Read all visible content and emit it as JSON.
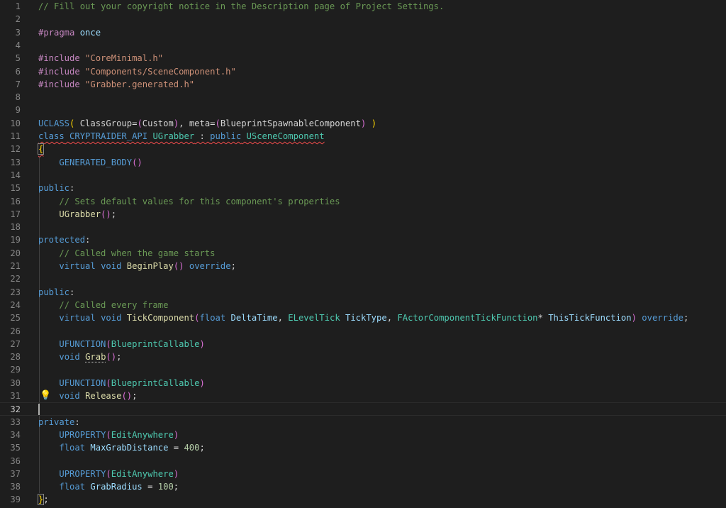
{
  "editor": {
    "bulb_icon": "lightbulb-icon",
    "line_numbers": [
      "1",
      "2",
      "3",
      "4",
      "5",
      "6",
      "7",
      "8",
      "9",
      "10",
      "11",
      "12",
      "13",
      "14",
      "15",
      "16",
      "17",
      "18",
      "19",
      "20",
      "21",
      "22",
      "23",
      "24",
      "25",
      "26",
      "27",
      "28",
      "29",
      "30",
      "31",
      "32",
      "33",
      "34",
      "35",
      "36",
      "37",
      "38",
      "39"
    ],
    "lines": [
      [
        {
          "t": "// Fill out your copyright notice in the Description page of Project Settings.",
          "c": "cm"
        }
      ],
      [],
      [
        {
          "t": "#pragma",
          "c": "pp"
        },
        {
          "t": " ",
          "c": "tx"
        },
        {
          "t": "once",
          "c": "var"
        }
      ],
      [],
      [
        {
          "t": "#include",
          "c": "pp"
        },
        {
          "t": " ",
          "c": "tx"
        },
        {
          "t": "\"CoreMinimal.h\"",
          "c": "str"
        }
      ],
      [
        {
          "t": "#include",
          "c": "pp"
        },
        {
          "t": " ",
          "c": "tx"
        },
        {
          "t": "\"Components/SceneComponent.h\"",
          "c": "str"
        }
      ],
      [
        {
          "t": "#include",
          "c": "pp"
        },
        {
          "t": " ",
          "c": "tx"
        },
        {
          "t": "\"Grabber.generated.h\"",
          "c": "str"
        }
      ],
      [],
      [],
      [
        {
          "t": "UCLASS",
          "c": "mac"
        },
        {
          "t": "(",
          "c": "pb1"
        },
        {
          "t": " ClassGroup=",
          "c": "tx"
        },
        {
          "t": "(",
          "c": "pb2"
        },
        {
          "t": "Custom",
          "c": "tx"
        },
        {
          "t": ")",
          "c": "pb2"
        },
        {
          "t": ", meta=",
          "c": "tx"
        },
        {
          "t": "(",
          "c": "pb2"
        },
        {
          "t": "BlueprintSpawnableComponent",
          "c": "tx"
        },
        {
          "t": ")",
          "c": "pb2"
        },
        {
          "t": " ",
          "c": "tx"
        },
        {
          "t": ")",
          "c": "pb1"
        }
      ],
      [
        {
          "t": "class",
          "c": "kw squig"
        },
        {
          "t": " ",
          "c": "tx squig"
        },
        {
          "t": "CRYPTRAIDER_API",
          "c": "mac squig"
        },
        {
          "t": " ",
          "c": "tx squig"
        },
        {
          "t": "UGrabber",
          "c": "ty squig"
        },
        {
          "t": " : ",
          "c": "tx squig"
        },
        {
          "t": "public",
          "c": "kw squig"
        },
        {
          "t": " ",
          "c": "tx squig"
        },
        {
          "t": "USceneComponent",
          "c": "ty squig"
        }
      ],
      [
        {
          "t": "{",
          "c": "pb1 squig bracket-box"
        }
      ],
      [
        {
          "t": "    ",
          "c": "tx"
        },
        {
          "t": "GENERATED_BODY",
          "c": "mac"
        },
        {
          "t": "()",
          "c": "pb2"
        }
      ],
      [],
      [
        {
          "t": "public",
          "c": "kw"
        },
        {
          "t": ":",
          "c": "tx"
        }
      ],
      [
        {
          "t": "    ",
          "c": "tx"
        },
        {
          "t": "// Sets default values for this component's properties",
          "c": "cm"
        }
      ],
      [
        {
          "t": "    ",
          "c": "tx"
        },
        {
          "t": "UGrabber",
          "c": "fn"
        },
        {
          "t": "()",
          "c": "pb2"
        },
        {
          "t": ";",
          "c": "tx"
        }
      ],
      [],
      [
        {
          "t": "protected",
          "c": "kw"
        },
        {
          "t": ":",
          "c": "tx"
        }
      ],
      [
        {
          "t": "    ",
          "c": "tx"
        },
        {
          "t": "// Called when the game starts",
          "c": "cm"
        }
      ],
      [
        {
          "t": "    ",
          "c": "tx"
        },
        {
          "t": "virtual",
          "c": "kw"
        },
        {
          "t": " ",
          "c": "tx"
        },
        {
          "t": "void",
          "c": "kw"
        },
        {
          "t": " ",
          "c": "tx"
        },
        {
          "t": "BeginPlay",
          "c": "fn"
        },
        {
          "t": "()",
          "c": "pb2"
        },
        {
          "t": " ",
          "c": "tx"
        },
        {
          "t": "override",
          "c": "kw"
        },
        {
          "t": ";",
          "c": "tx"
        }
      ],
      [],
      [
        {
          "t": "public",
          "c": "kw"
        },
        {
          "t": ":",
          "c": "tx"
        }
      ],
      [
        {
          "t": "    ",
          "c": "tx"
        },
        {
          "t": "// Called every frame",
          "c": "cm"
        }
      ],
      [
        {
          "t": "    ",
          "c": "tx"
        },
        {
          "t": "virtual",
          "c": "kw"
        },
        {
          "t": " ",
          "c": "tx"
        },
        {
          "t": "void",
          "c": "kw"
        },
        {
          "t": " ",
          "c": "tx"
        },
        {
          "t": "TickComponent",
          "c": "fn"
        },
        {
          "t": "(",
          "c": "pb2"
        },
        {
          "t": "float",
          "c": "kw"
        },
        {
          "t": " ",
          "c": "tx"
        },
        {
          "t": "DeltaTime",
          "c": "var"
        },
        {
          "t": ", ",
          "c": "tx"
        },
        {
          "t": "ELevelTick",
          "c": "ty"
        },
        {
          "t": " ",
          "c": "tx"
        },
        {
          "t": "TickType",
          "c": "var"
        },
        {
          "t": ", ",
          "c": "tx"
        },
        {
          "t": "FActorComponentTickFunction",
          "c": "ty"
        },
        {
          "t": "* ",
          "c": "tx"
        },
        {
          "t": "ThisTickFunction",
          "c": "var"
        },
        {
          "t": ")",
          "c": "pb2"
        },
        {
          "t": " ",
          "c": "tx"
        },
        {
          "t": "override",
          "c": "kw"
        },
        {
          "t": ";",
          "c": "tx"
        }
      ],
      [],
      [
        {
          "t": "    ",
          "c": "tx"
        },
        {
          "t": "UFUNCTION",
          "c": "mac"
        },
        {
          "t": "(",
          "c": "pb2"
        },
        {
          "t": "BlueprintCallable",
          "c": "ty"
        },
        {
          "t": ")",
          "c": "pb2"
        }
      ],
      [
        {
          "t": "    ",
          "c": "tx"
        },
        {
          "t": "void",
          "c": "kw"
        },
        {
          "t": " ",
          "c": "tx"
        },
        {
          "t": "Grab",
          "c": "fn dots"
        },
        {
          "t": "()",
          "c": "pb2"
        },
        {
          "t": ";",
          "c": "tx"
        }
      ],
      [],
      [
        {
          "t": "    ",
          "c": "tx"
        },
        {
          "t": "UFUNCTION",
          "c": "mac"
        },
        {
          "t": "(",
          "c": "pb2"
        },
        {
          "t": "BlueprintCallable",
          "c": "ty"
        },
        {
          "t": ")",
          "c": "pb2"
        }
      ],
      [
        {
          "t": "    ",
          "c": "tx"
        },
        {
          "t": "void",
          "c": "kw"
        },
        {
          "t": " ",
          "c": "tx"
        },
        {
          "t": "Release",
          "c": "fn"
        },
        {
          "t": "()",
          "c": "pb2"
        },
        {
          "t": ";",
          "c": "tx"
        }
      ],
      [],
      [
        {
          "t": "private",
          "c": "kw"
        },
        {
          "t": ":",
          "c": "tx"
        }
      ],
      [
        {
          "t": "    ",
          "c": "tx"
        },
        {
          "t": "UPROPERTY",
          "c": "mac"
        },
        {
          "t": "(",
          "c": "pb2"
        },
        {
          "t": "EditAnywhere",
          "c": "ty"
        },
        {
          "t": ")",
          "c": "pb2"
        }
      ],
      [
        {
          "t": "    ",
          "c": "tx"
        },
        {
          "t": "float",
          "c": "kw"
        },
        {
          "t": " ",
          "c": "tx"
        },
        {
          "t": "MaxGrabDistance",
          "c": "var"
        },
        {
          "t": " = ",
          "c": "tx"
        },
        {
          "t": "400",
          "c": "num"
        },
        {
          "t": ";",
          "c": "tx"
        }
      ],
      [],
      [
        {
          "t": "    ",
          "c": "tx"
        },
        {
          "t": "UPROPERTY",
          "c": "mac"
        },
        {
          "t": "(",
          "c": "pb2"
        },
        {
          "t": "EditAnywhere",
          "c": "ty"
        },
        {
          "t": ")",
          "c": "pb2"
        }
      ],
      [
        {
          "t": "    ",
          "c": "tx"
        },
        {
          "t": "float",
          "c": "kw"
        },
        {
          "t": " ",
          "c": "tx"
        },
        {
          "t": "GrabRadius",
          "c": "var"
        },
        {
          "t": " = ",
          "c": "tx"
        },
        {
          "t": "100",
          "c": "num"
        },
        {
          "t": ";",
          "c": "tx"
        }
      ],
      [
        {
          "t": "}",
          "c": "pb1 bracket-box"
        },
        {
          "t": ";",
          "c": "tx"
        }
      ]
    ]
  }
}
